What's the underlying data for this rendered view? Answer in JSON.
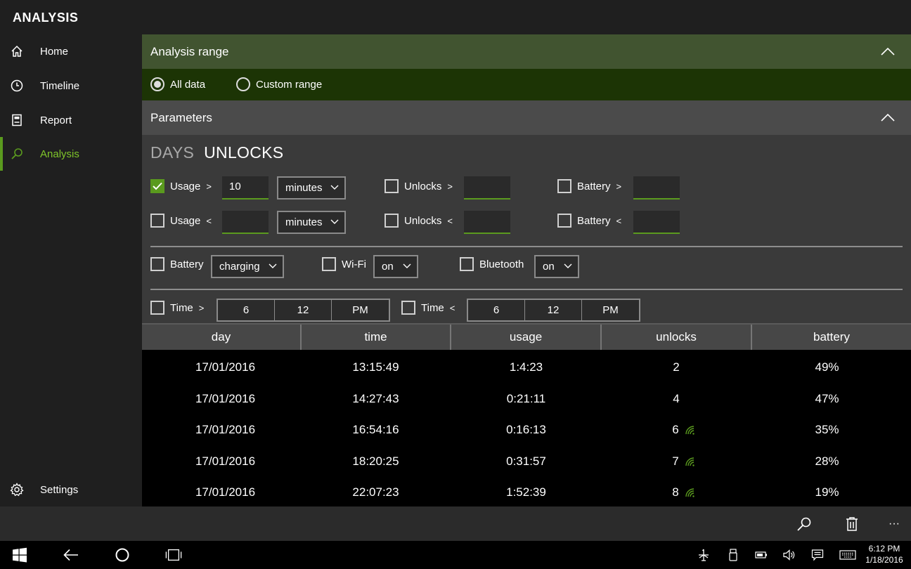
{
  "app": {
    "title": "ANALYSIS"
  },
  "sidebar": {
    "items": [
      {
        "label": "Home",
        "icon": "home-icon"
      },
      {
        "label": "Timeline",
        "icon": "clock-icon"
      },
      {
        "label": "Report",
        "icon": "report-icon"
      },
      {
        "label": "Analysis",
        "icon": "search-icon",
        "active": true
      }
    ],
    "settings": {
      "label": "Settings",
      "icon": "gear-icon"
    }
  },
  "range": {
    "title": "Analysis range",
    "options": [
      {
        "label": "All data",
        "selected": true
      },
      {
        "label": "Custom range",
        "selected": false
      }
    ]
  },
  "parameters": {
    "title": "Parameters",
    "tabs": [
      {
        "label": "DAYS",
        "active": false
      },
      {
        "label": "UNLOCKS",
        "active": true
      }
    ],
    "usage_gt": {
      "label": "Usage",
      "op": ">",
      "checked": true,
      "value": "10",
      "unit": "minutes"
    },
    "usage_lt": {
      "label": "Usage",
      "op": "<",
      "checked": false,
      "value": "",
      "unit": "minutes"
    },
    "unlocks_gt": {
      "label": "Unlocks",
      "op": ">",
      "checked": false,
      "value": ""
    },
    "unlocks_lt": {
      "label": "Unlocks",
      "op": "<",
      "checked": false,
      "value": ""
    },
    "battery_gt": {
      "label": "Battery",
      "op": ">",
      "checked": false,
      "value": ""
    },
    "battery_lt": {
      "label": "Battery",
      "op": "<",
      "checked": false,
      "value": ""
    },
    "battery_state": {
      "label": "Battery",
      "checked": false,
      "value": "charging"
    },
    "wifi": {
      "label": "Wi-Fi",
      "checked": false,
      "value": "on"
    },
    "bluetooth": {
      "label": "Bluetooth",
      "checked": false,
      "value": "on"
    },
    "time_gt": {
      "label": "Time",
      "op": ">",
      "checked": false,
      "hour": "6",
      "minute": "12",
      "ampm": "PM"
    },
    "time_lt": {
      "label": "Time",
      "op": "<",
      "checked": false,
      "hour": "6",
      "minute": "12",
      "ampm": "PM"
    }
  },
  "table": {
    "columns": [
      "day",
      "time",
      "usage",
      "unlocks",
      "battery"
    ],
    "rows": [
      {
        "day": "17/01/2016",
        "time": "13:15:49",
        "usage": "1:4:23",
        "unlocks": "2",
        "wifi": false,
        "battery": "49%"
      },
      {
        "day": "17/01/2016",
        "time": "14:27:43",
        "usage": "0:21:11",
        "unlocks": "4",
        "wifi": false,
        "battery": "47%"
      },
      {
        "day": "17/01/2016",
        "time": "16:54:16",
        "usage": "0:16:13",
        "unlocks": "6",
        "wifi": true,
        "battery": "35%"
      },
      {
        "day": "17/01/2016",
        "time": "18:20:25",
        "usage": "0:31:57",
        "unlocks": "7",
        "wifi": true,
        "battery": "28%"
      },
      {
        "day": "17/01/2016",
        "time": "22:07:23",
        "usage": "1:52:39",
        "unlocks": "8",
        "wifi": true,
        "battery": "19%"
      }
    ]
  },
  "appbar": {
    "icons": [
      "search-icon",
      "delete-icon",
      "more-icon"
    ],
    "more_glyph": "···"
  },
  "taskbar": {
    "icons": [
      "windows-start-icon",
      "back-icon",
      "cortana-icon",
      "task-view-icon"
    ],
    "tray": [
      "airplane-mode-icon",
      "usb-icon",
      "battery-icon",
      "volume-icon",
      "action-center-icon",
      "keyboard-icon"
    ],
    "time": "6:12 PM",
    "date": "1/18/2016"
  },
  "colors": {
    "accent": "#5a9a1e",
    "range_header": "#415430",
    "range_body": "#1c3405",
    "params_header": "#4b4b4b",
    "panel": "#3a3a3a"
  }
}
